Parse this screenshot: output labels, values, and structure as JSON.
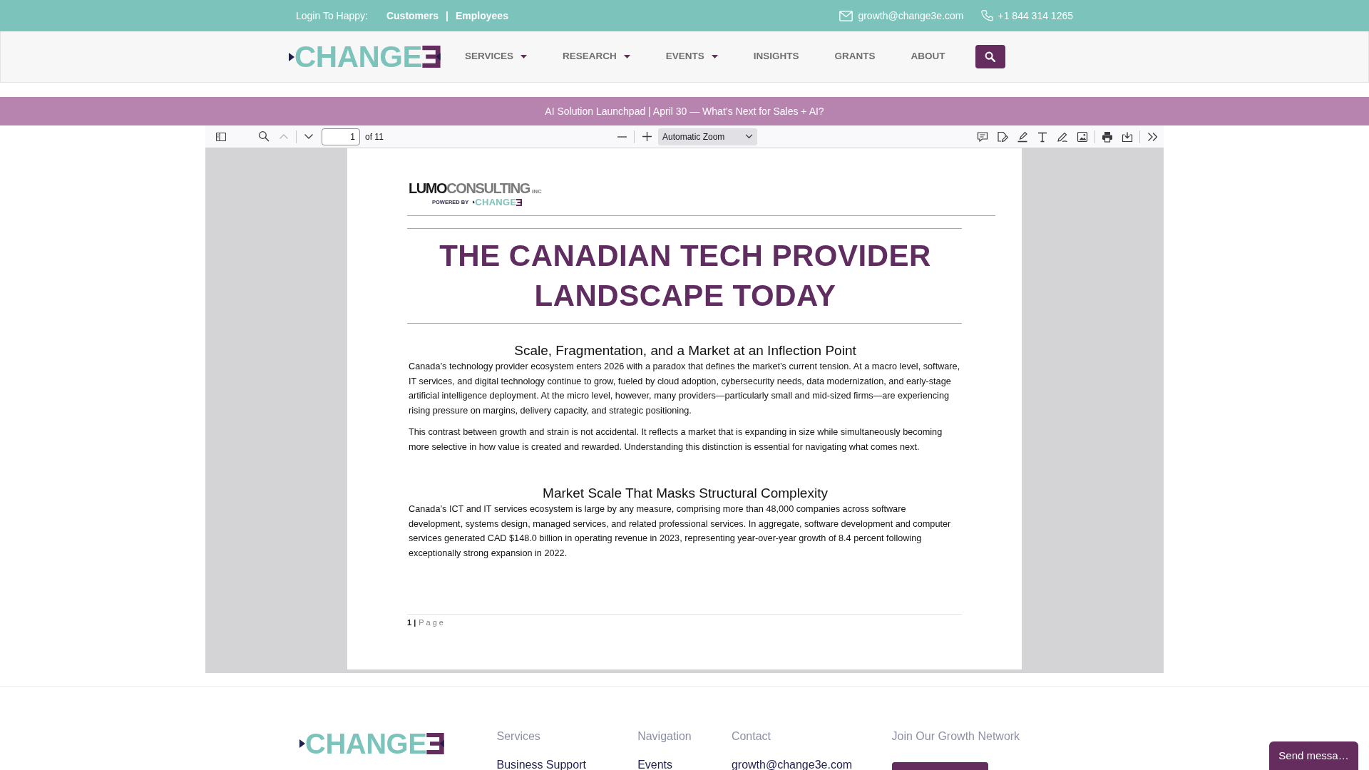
{
  "top_bar": {
    "login_label": "Login To Happy:",
    "login_links": [
      {
        "label": "Customers"
      },
      {
        "label": "Employees"
      }
    ],
    "separator": "|",
    "email": "growth@change3e.com",
    "phone": "+1 844 314 1265"
  },
  "navbar": {
    "logo": "CHANGE",
    "items": [
      {
        "label": "SERVICES",
        "dropdown": true
      },
      {
        "label": "RESEARCH",
        "dropdown": true
      },
      {
        "label": "EVENTS",
        "dropdown": true
      },
      {
        "label": "INSIGHTS",
        "dropdown": false
      },
      {
        "label": "GRANTS",
        "dropdown": false
      },
      {
        "label": "ABOUT",
        "dropdown": false
      }
    ]
  },
  "announcement": {
    "text": "AI Solution Launchpad | April 30 — What’s Next for Sales + AI?"
  },
  "pdf_viewer": {
    "toolbar": {
      "previous_page": {
        "disabled": true
      },
      "next_page": {
        "disabled": false
      },
      "page_number": "1",
      "page_count": "of 11",
      "zoom": "Automatic Zoom"
    },
    "page": {
      "logo": {
        "name_bold": "LUMO",
        "name_light": "CONSULTING",
        "suffix": "INC",
        "tagline": "POWERED BY",
        "partner": "CHANGE"
      },
      "title": "THE CANADIAN TECH PROVIDER LANDSCAPE TODAY",
      "sections": [
        {
          "heading": "Scale, Fragmentation, and a Market at an Inflection Point",
          "paragraphs": [
            "Canada’s technology provider ecosystem enters 2026 with a paradox that defines the market’s current tension. At a macro level, software, IT services, and digital technology continue to grow, fueled by cloud adoption, cybersecurity needs, data modernization, and early-stage artificial intelligence deployment. At the micro level, however, many providers—particularly small and mid-sized firms—are experiencing rising pressure on margins, delivery capacity, and strategic positioning.",
            "This contrast between growth and strain is not accidental. It reflects a market that is expanding in size while simultaneously becoming more selective in how value is created and rewarded. Understanding this distinction is essential for navigating what comes next."
          ]
        },
        {
          "heading": "Market Scale That Masks Structural Complexity",
          "paragraphs": [
            "Canada’s ICT and IT services ecosystem is large by any measure, comprising more than 48,000 companies across software development, systems design, managed services, and related professional services. In aggregate, software development and computer services generated CAD $148.0 billion in operating revenue in 2023, representing year-over-year growth of 8.4 percent following exceptionally strong expansion in 2022."
          ]
        }
      ],
      "footer": {
        "number": "1 |",
        "label": "Page"
      }
    }
  },
  "footer": {
    "logo": "CHANGE",
    "columns": [
      {
        "kind": "links",
        "heading": "Services",
        "links": [
          "Business Support"
        ]
      },
      {
        "kind": "links",
        "heading": "Navigation",
        "links": [
          "Events"
        ]
      },
      {
        "kind": "links",
        "heading": "Contact",
        "links": [
          "growth@change3e.com"
        ]
      },
      {
        "kind": "button",
        "heading": "Join Our Growth Network"
      }
    ]
  },
  "chat_button": {
    "label": "Send messa…"
  }
}
